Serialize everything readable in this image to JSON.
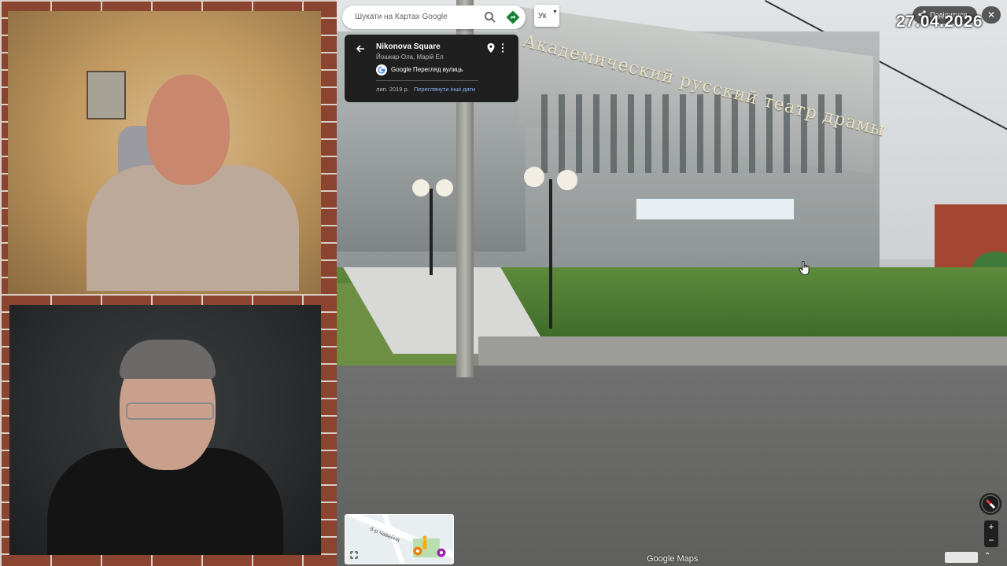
{
  "search": {
    "placeholder": "Шукати на Картах Google"
  },
  "language_button": {
    "label": "Ук"
  },
  "place_card": {
    "name": "Nikonova Square",
    "location": "Йошкар-Ола, Марій Ел",
    "source": "Google Перегляд вулиць",
    "capture_date": "лип. 2019 р.",
    "other_dates_link": "Переглянути інші дати"
  },
  "top_right": {
    "share_label": "Поділитися",
    "date_overlay": "27.04.2026"
  },
  "panorama": {
    "building_sign": "Академический русский театр драмы"
  },
  "minimap": {
    "street_label": "б-р Чавайна"
  },
  "footer": {
    "logo": "Google Maps"
  },
  "zoom": {
    "plus": "+",
    "minus": "−"
  },
  "colors": {
    "card_bg": "#1f1f1f",
    "link_blue": "#8ab4f8",
    "accent_green": "#188038"
  }
}
